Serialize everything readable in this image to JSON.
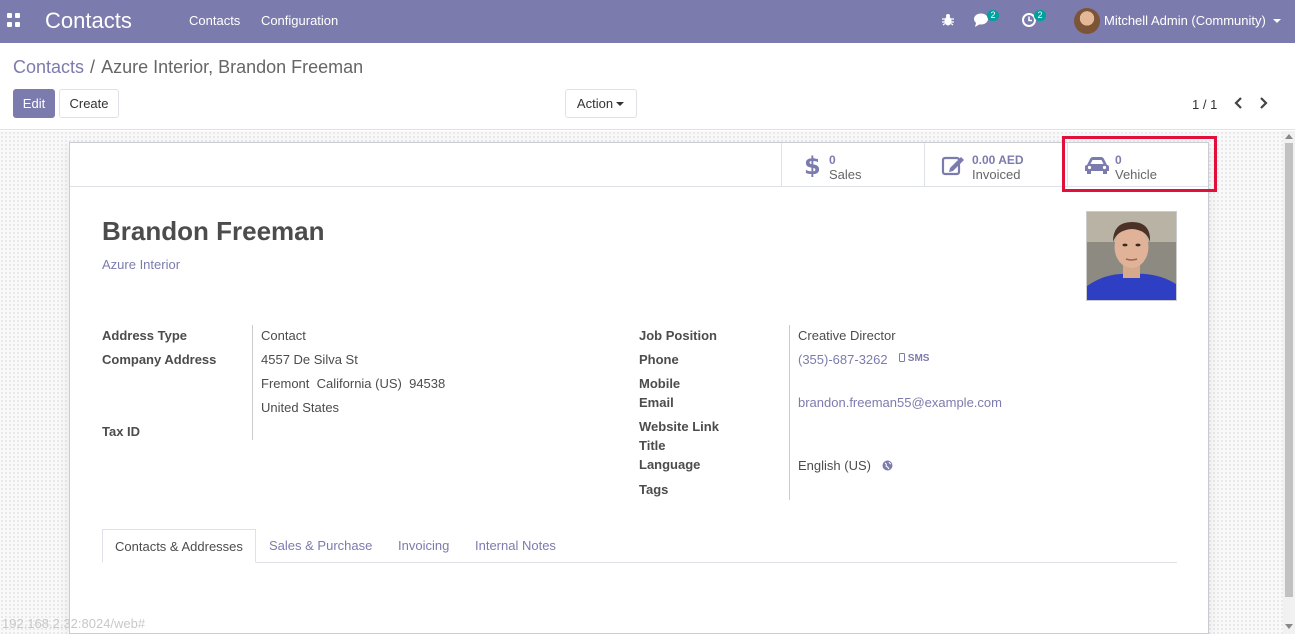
{
  "navbar": {
    "app_title": "Contacts",
    "menu": [
      "Contacts",
      "Configuration"
    ],
    "chat_count": "2",
    "activity_count": "2",
    "user_name": "Mitchell Admin (Community)"
  },
  "control_panel": {
    "breadcrumb_parent": "Contacts",
    "breadcrumb_separator": "/",
    "breadcrumb_current": "Azure Interior, Brandon Freeman",
    "edit_label": "Edit",
    "create_label": "Create",
    "action_label": "Action",
    "pager": "1 / 1"
  },
  "smart_buttons": {
    "sales_value": "0",
    "sales_label": "Sales",
    "invoiced_value": "0.00 AED",
    "invoiced_label": "Invoiced",
    "vehicle_value": "0",
    "vehicle_label": "Vehicle"
  },
  "partner": {
    "name": "Brandon Freeman",
    "company": "Azure Interior"
  },
  "left_fields": {
    "address_type_label": "Address Type",
    "address_type_value": "Contact",
    "company_address_label": "Company Address",
    "street": "4557 De Silva St",
    "city_line": "Fremont  California (US)  94538",
    "country": "United States",
    "tax_id_label": "Tax ID"
  },
  "right_fields": {
    "job_position_label": "Job Position",
    "job_position_value": "Creative Director",
    "phone_label": "Phone",
    "phone_value": "(355)-687-3262",
    "sms_label": "SMS",
    "mobile_label": "Mobile",
    "email_label": "Email",
    "email_value": "brandon.freeman55@example.com",
    "website_label": "Website Link",
    "title_label": "Title",
    "language_label": "Language",
    "language_value": "English (US)",
    "tags_label": "Tags"
  },
  "tabs": [
    "Contacts & Addresses",
    "Sales & Purchase",
    "Invoicing",
    "Internal Notes"
  ],
  "status_url": "192.168.2.32:8024/web#",
  "colors": {
    "brand": "#7c7bad",
    "badge": "#00a09d",
    "highlight": "#e0103a"
  }
}
